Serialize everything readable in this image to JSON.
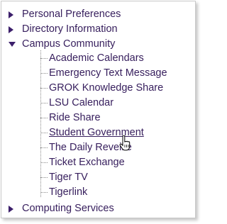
{
  "tree": {
    "top_items": [
      {
        "label": "Personal Preferences",
        "state": "collapsed"
      },
      {
        "label": "Directory Information",
        "state": "collapsed"
      },
      {
        "label": "Campus Community",
        "state": "expanded"
      },
      {
        "label": "Computing Services",
        "state": "collapsed"
      }
    ],
    "campus_children": [
      "Academic Calendars",
      "Emergency Text Message",
      "GROK Knowledge Share",
      "LSU Calendar",
      "Ride Share",
      "Student Government",
      "The Daily Reveille",
      "Ticket Exchange",
      "Tiger TV",
      "Tigerlink"
    ],
    "hovered_item": "Student Government"
  },
  "colors": {
    "link_text": "#38205e",
    "arrow": "#3c1f6b",
    "border": "#c9c9c9",
    "tree_lines": "#8a8a8a"
  },
  "icons": {
    "collapsed": "triangle-right-icon",
    "expanded": "triangle-down-icon",
    "cursor": "hand-pointer-icon"
  }
}
